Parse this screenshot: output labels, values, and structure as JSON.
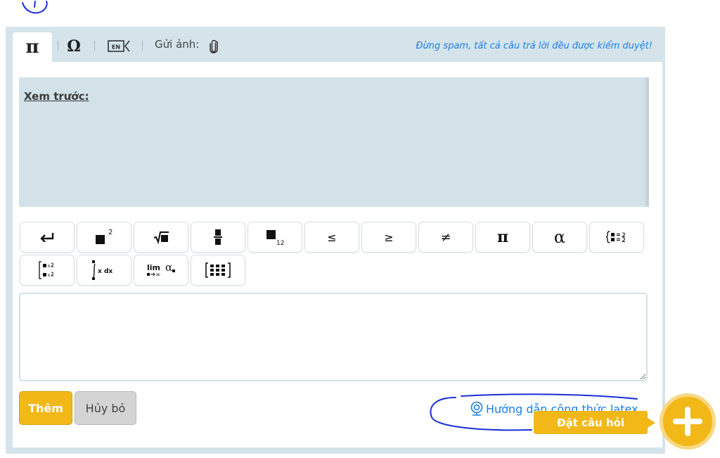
{
  "toolbar": {
    "tab_math_symbol": "π",
    "tab_special_symbol": "Ω",
    "tab_language": "EN",
    "send_image_label": "Gửi ảnh:",
    "notice": "Đừng spam, tất cả câu trả lời đều được kiểm duyệt!"
  },
  "preview": {
    "label": "Xem trước:"
  },
  "math_buttons": {
    "less_equal": "≤",
    "greater_equal": "≥",
    "not_equal": "≠",
    "pi": "π",
    "alpha": "α",
    "sup_exponent": "2",
    "sub_index": "12",
    "integral_text": "x dx",
    "limit_text": "lim",
    "limit_alpha": "α"
  },
  "actions": {
    "add_label": "Thêm",
    "cancel_label": "Hủy bỏ",
    "latex_guide_label": "Hướng dẫn công thức latex"
  },
  "ask": {
    "label": "Đặt câu hỏi"
  },
  "colors": {
    "accent": "#f2b818",
    "panel_bg": "#d4e4ea",
    "link": "#1c7fe6",
    "annotation": "#1a2fd6"
  },
  "icons": {
    "tab_math": "pi-icon",
    "tab_symbol": "omega-icon",
    "tab_lang": "keyboard-en-icon",
    "attach": "paperclip-icon",
    "guide": "webcam-icon",
    "fab": "plus-icon"
  }
}
